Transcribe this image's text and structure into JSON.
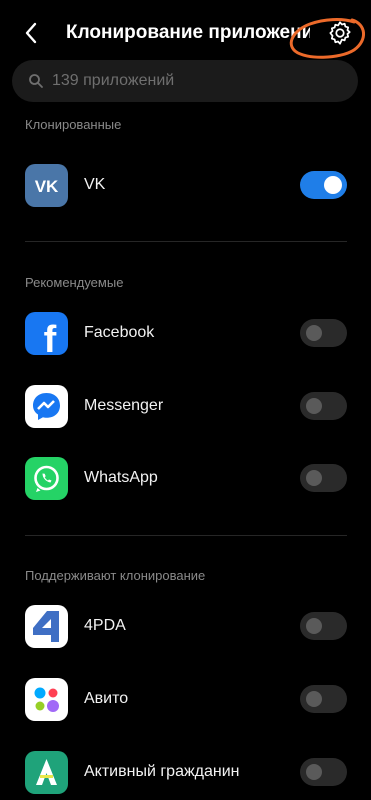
{
  "header": {
    "title": "Клонирование приложений"
  },
  "search": {
    "placeholder": "139 приложений"
  },
  "sections": {
    "cloned_label": "Клонированные",
    "recommended_label": "Рекомендуемые",
    "supported_label": "Поддерживают клонирование"
  },
  "apps": {
    "vk": {
      "name": "VK",
      "enabled": true,
      "icon": "vk-logo-icon"
    },
    "facebook": {
      "name": "Facebook",
      "enabled": false,
      "icon": "facebook-logo-icon"
    },
    "messenger": {
      "name": "Messenger",
      "enabled": false,
      "icon": "messenger-logo-icon"
    },
    "whatsapp": {
      "name": "WhatsApp",
      "enabled": false,
      "icon": "whatsapp-logo-icon"
    },
    "4pda": {
      "name": "4PDA",
      "enabled": false,
      "icon": "4pda-logo-icon"
    },
    "avito": {
      "name": "Авито",
      "enabled": false,
      "icon": "avito-logo-icon"
    },
    "active_citizen": {
      "name": "Активный гражданин",
      "enabled": false,
      "icon": "active-citizen-logo-icon"
    }
  },
  "colors": {
    "background": "#000000",
    "toggle_on": "#1f7ee8",
    "toggle_off": "#2a2a2a",
    "annotation": "#ec6a2a"
  }
}
